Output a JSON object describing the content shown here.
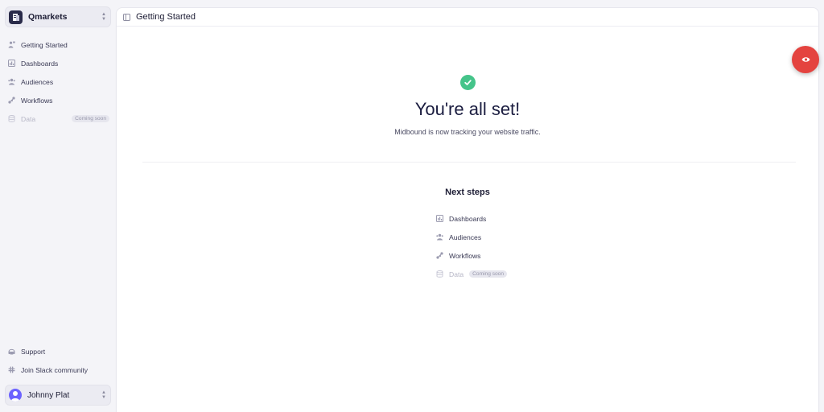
{
  "sidebar": {
    "workspace": {
      "name": "Qmarkets"
    },
    "nav": [
      {
        "label": "Getting Started",
        "icon": "person-flag-icon"
      },
      {
        "label": "Dashboards",
        "icon": "chart-grid-icon"
      },
      {
        "label": "Audiences",
        "icon": "users-icon"
      },
      {
        "label": "Workflows",
        "icon": "nodes-icon"
      },
      {
        "label": "Data",
        "icon": "database-icon",
        "badge": "Coming soon",
        "disabled": true
      }
    ],
    "bottom": [
      {
        "label": "Support",
        "icon": "support-icon"
      },
      {
        "label": "Join Slack community",
        "icon": "slack-icon"
      }
    ],
    "user": {
      "name": "Johnny Plat"
    }
  },
  "header": {
    "title": "Getting Started"
  },
  "main": {
    "headline": "You're all set!",
    "subtext": "Midbound is now tracking your website traffic.",
    "next_steps_title": "Next steps",
    "next_steps": [
      {
        "label": "Dashboards"
      },
      {
        "label": "Audiences"
      },
      {
        "label": "Workflows"
      },
      {
        "label": "Data",
        "badge": "Coming soon",
        "disabled": true
      }
    ]
  },
  "colors": {
    "accent_green": "#45c48a",
    "fab_red": "#e4433f",
    "avatar": "#6c63ff"
  }
}
